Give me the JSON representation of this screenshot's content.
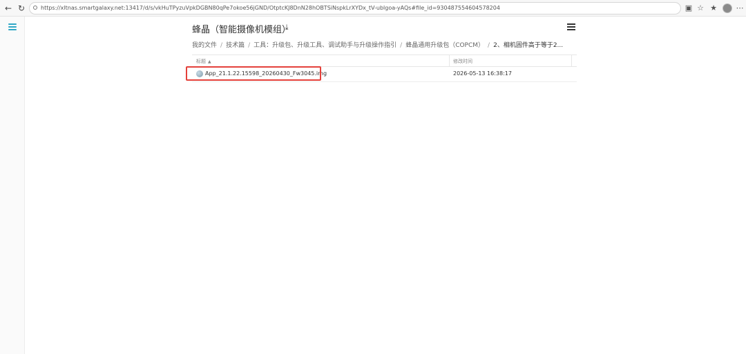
{
  "browser": {
    "url": "https://xltnas.smartgalaxy.net:13417/d/s/vkHuTPyzuVpkDGBN80qPe7okoe56jGND/OtptcKJ8DnN28hOBTSiNspkLrXYDx_tV-ublgoa-yAQs#file_id=930487554604578204",
    "back_icon": "arrow-left",
    "reload_icon": "reload",
    "lock_icon": "lock"
  },
  "header": {
    "title": "蜂晶（智能摄像机模组）",
    "download_icon": "download",
    "menu_icon": "hamburger"
  },
  "breadcrumb": [
    "我的文件",
    "技术篇",
    "工具：升级包、升级工具、调试助手与升级操作指引",
    "蜂晶通用升级包（COPCM）",
    "2、相机固件高于等于2..."
  ],
  "table": {
    "columns": {
      "title": "标题",
      "modified": "修改时间"
    },
    "rows": [
      {
        "name": "App_21.1.22.15598_20260430_Fw3045.img",
        "modified": "2026-05-13 16:38:17"
      }
    ]
  },
  "colors": {
    "accent": "#2fa7c6",
    "highlight": "#e4403a"
  }
}
